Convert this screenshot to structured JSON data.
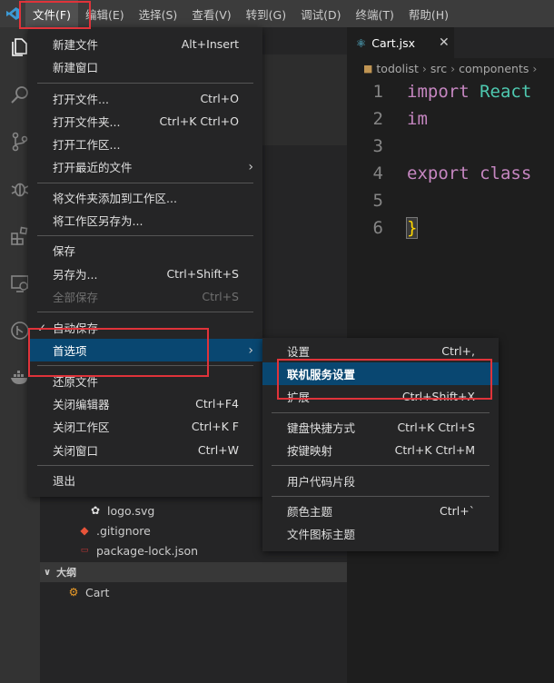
{
  "menubar": {
    "items": [
      "文件(F)",
      "编辑(E)",
      "选择(S)",
      "查看(V)",
      "转到(G)",
      "调试(D)",
      "终端(T)",
      "帮助(H)"
    ]
  },
  "file_menu": {
    "new_file": {
      "label": "新建文件",
      "shortcut": "Alt+Insert"
    },
    "new_window": {
      "label": "新建窗口"
    },
    "open_file": {
      "label": "打开文件...",
      "shortcut": "Ctrl+O"
    },
    "open_folder": {
      "label": "打开文件夹...",
      "shortcut": "Ctrl+K Ctrl+O"
    },
    "open_workspace": {
      "label": "打开工作区..."
    },
    "open_recent": {
      "label": "打开最近的文件"
    },
    "add_folder_workspace": {
      "label": "将文件夹添加到工作区..."
    },
    "save_workspace_as": {
      "label": "将工作区另存为..."
    },
    "save": {
      "label": "保存"
    },
    "save_as": {
      "label": "另存为...",
      "shortcut": "Ctrl+Shift+S"
    },
    "save_all": {
      "label": "全部保存",
      "shortcut": "Ctrl+S"
    },
    "auto_save": {
      "label": "自动保存"
    },
    "preferences": {
      "label": "首选项"
    },
    "revert_file": {
      "label": "还原文件"
    },
    "close_editor": {
      "label": "关闭编辑器",
      "shortcut": "Ctrl+F4"
    },
    "close_workspace": {
      "label": "关闭工作区",
      "shortcut": "Ctrl+K F"
    },
    "close_window": {
      "label": "关闭窗口",
      "shortcut": "Ctrl+W"
    },
    "exit": {
      "label": "退出"
    }
  },
  "prefs_submenu": {
    "settings": {
      "label": "设置",
      "shortcut": "Ctrl+,"
    },
    "online_services": {
      "label": "联机服务设置"
    },
    "extensions": {
      "label": "扩展",
      "shortcut": "Ctrl+Shift+X"
    },
    "keyboard_shortcuts": {
      "label": "键盘快捷方式",
      "shortcut": "Ctrl+K Ctrl+S"
    },
    "keymaps": {
      "label": "按键映射",
      "shortcut": "Ctrl+K Ctrl+M"
    },
    "user_snippets": {
      "label": "用户代码片段"
    },
    "color_theme": {
      "label": "颜色主题",
      "shortcut": "Ctrl+`"
    },
    "file_icon_theme": {
      "label": "文件图标主题"
    }
  },
  "sidebar": {
    "files": [
      "logo.svg",
      ".gitignore",
      "package-lock.json"
    ],
    "outline_header": "大纲",
    "outline_items": [
      "Cart"
    ]
  },
  "editor": {
    "tab_title": "Cart.jsx",
    "breadcrumb": [
      "todolist",
      "src",
      "components"
    ],
    "line_numbers": [
      "1",
      "2",
      "3",
      "4",
      "5",
      "6"
    ],
    "lines": {
      "l1_kw": "import",
      "l1_rest": " React",
      "l2": "im",
      "l4_kw": "export",
      "l4_rest": " class",
      "l6": "}"
    }
  },
  "colors": {
    "accent_highlight": "#094771",
    "annotation_red": "#e0333a",
    "keyword": "#c586c0"
  }
}
